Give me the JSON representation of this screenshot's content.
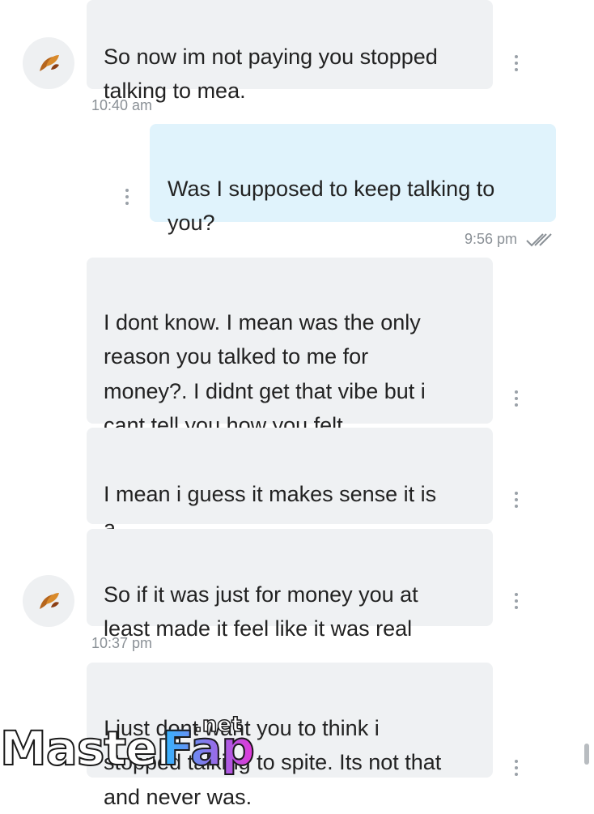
{
  "messages": [
    {
      "text": "So now im not paying you stopped\ntalking to mea."
    },
    {
      "text": "Was I supposed to keep talking to\nyou?"
    },
    {
      "text": "I dont know. I mean was the only\nreason you talked to me for\nmoney?. I didnt get that vibe but i\ncant tell you how you felt"
    },
    {
      "text": "I mean i guess it makes sense it is a\npay site"
    },
    {
      "text": "So if it was just for money you at\nleast made it feel like it was real"
    },
    {
      "text": "I just dont want you to think i\nstopped talking to spite. Its not that\nand never was."
    }
  ],
  "timestamps": {
    "t1": "10:40 am",
    "t2": "9:56 pm",
    "t3": "10:37 pm"
  },
  "watermark": {
    "part1": "Master",
    "part2": "Fap",
    "part3": ".net"
  },
  "icons": {
    "avatar": "leaf-avatar-icon",
    "menu": "more-vertical-icon",
    "read": "double-check-icon"
  },
  "colors": {
    "incoming_bubble": "#eff1f3",
    "outgoing_bubble": "#e0f3fc",
    "text": "#222222",
    "meta": "#8a9096"
  }
}
